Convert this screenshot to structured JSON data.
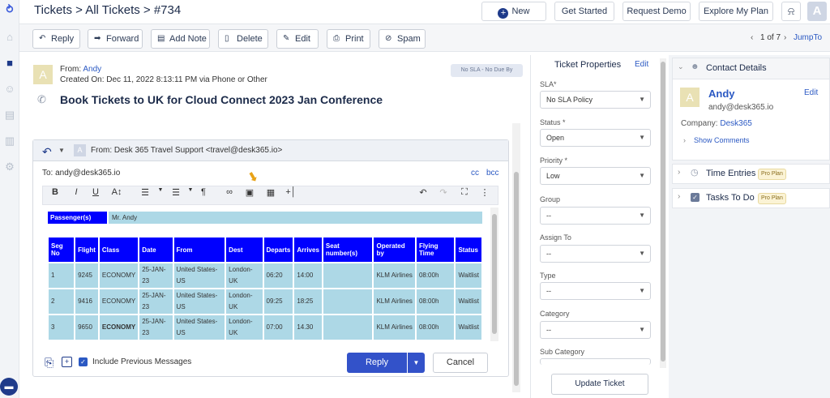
{
  "header": {
    "breadcrumb": "Tickets > All Tickets > #734",
    "new_label": "New",
    "get_started": "Get Started",
    "request_demo": "Request Demo",
    "explore_plan": "Explore My Plan",
    "avatar_letter": "A"
  },
  "actions": {
    "reply": "Reply",
    "forward": "Forward",
    "add_note": "Add Note",
    "delete": "Delete",
    "edit": "Edit",
    "print": "Print",
    "spam": "Spam",
    "pager": "1 of 7",
    "jump_to": "JumpTo"
  },
  "ticket": {
    "from_label": "From:",
    "from_name": "Andy",
    "created": "Created On: Dec 11, 2022 8:13:11 PM via Phone or Other",
    "sla_badge": "No SLA - No Due By",
    "subject": "Book Tickets to UK for Cloud Connect 2023 Jan Conference",
    "avatar_letter": "A"
  },
  "reply_editor": {
    "from_line": "From: Desk 365 Travel Support <travel@desk365.io>",
    "to_line": "To: andy@desk365.io",
    "cc": "cc",
    "bcc": "bcc",
    "include_previous": "Include Previous Messages",
    "reply_button": "Reply",
    "cancel_button": "Cancel",
    "avatar_letter": "A"
  },
  "passenger": {
    "label": "Passenger(s)",
    "value": "Mr. Andy"
  },
  "flight_table": {
    "headers": [
      "Seg No",
      "Flight",
      "Class",
      "Date",
      "From",
      "Dest",
      "Departs",
      "Arrives",
      "Seat number(s)",
      "Operated by",
      "Flying Time",
      "Status"
    ],
    "rows": [
      [
        "1",
        "9245",
        "ECONOMY",
        "25-JAN-23",
        "United States- US",
        "London-UK",
        "06:20",
        "14:00",
        "",
        "KLM Airlines",
        "08:00h",
        "Waitlist"
      ],
      [
        "2",
        "9416",
        "ECONOMY",
        "25-JAN-23",
        "United States- US",
        "London-UK",
        "09:25",
        "18:25",
        "",
        "KLM Airlines",
        "08:00h",
        "Waitlist"
      ],
      [
        "3",
        "9650",
        "ECONOMY",
        "25-JAN-23",
        "United States- US",
        "London-UK",
        "07:00",
        "14.30",
        "",
        "KLM Airlines",
        "08:00h",
        "Waitlist"
      ]
    ]
  },
  "properties": {
    "title": "Ticket Properties",
    "edit": "Edit",
    "sla_label": "SLA*",
    "sla_value": "No SLA Policy",
    "status_label": "Status *",
    "status_value": "Open",
    "priority_label": "Priority *",
    "priority_value": "Low",
    "group_label": "Group",
    "group_value": "--",
    "assign_label": "Assign To",
    "assign_value": "--",
    "type_label": "Type",
    "type_value": "--",
    "category_label": "Category",
    "category_value": "--",
    "subcategory_label": "Sub Category",
    "subcategory_value": "--",
    "update_button": "Update Ticket"
  },
  "contact": {
    "title": "Contact Details",
    "name": "Andy",
    "edit": "Edit",
    "email": "andy@desk365.io",
    "company_label": "Company:",
    "company": "Desk365",
    "show_comments": "Show Comments",
    "avatar_letter": "A"
  },
  "panels": {
    "time_entries": "Time Entries",
    "tasks": "Tasks To Do",
    "pro_plan": "Pro Plan"
  }
}
